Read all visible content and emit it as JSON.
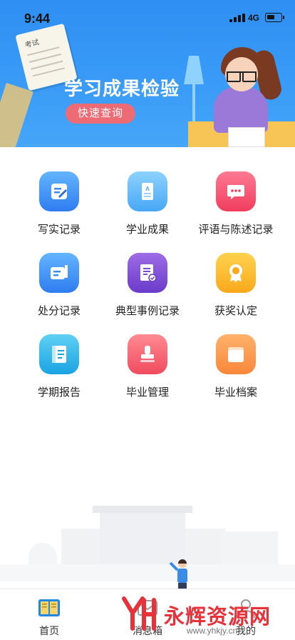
{
  "status_bar": {
    "time": "9:44",
    "network": "4G"
  },
  "banner": {
    "title": "学习成果检验",
    "button_label": "快速查询",
    "paper_text": "考试"
  },
  "grid": {
    "items": [
      {
        "label": "写实记录",
        "icon": "edit-note-icon",
        "color": "#3b8cf4"
      },
      {
        "label": "学业成果",
        "icon": "document-a-icon",
        "color": "#4aa8f6"
      },
      {
        "label": "评语与陈述记录",
        "icon": "chat-bubble-icon",
        "color": "#f24662"
      },
      {
        "label": "处分记录",
        "icon": "card-pen-icon",
        "color": "#3b8cf4"
      },
      {
        "label": "典型事例记录",
        "icon": "checklist-icon",
        "color": "#7b4bd3"
      },
      {
        "label": "获奖认定",
        "icon": "award-medal-icon",
        "color": "#fab327"
      },
      {
        "label": "学期报告",
        "icon": "report-book-icon",
        "color": "#2bb5ea"
      },
      {
        "label": "毕业管理",
        "icon": "stamp-icon",
        "color": "#f25468"
      },
      {
        "label": "毕业档案",
        "icon": "folder-archive-icon",
        "color": "#f99645"
      }
    ]
  },
  "tabbar": {
    "tabs": [
      {
        "label": "首页",
        "icon": "book-home-icon",
        "active": true
      },
      {
        "label": "消息箱",
        "icon": "message-box-icon",
        "active": false
      },
      {
        "label": "我的",
        "icon": "person-icon",
        "active": false
      }
    ]
  },
  "watermark": {
    "text": "永辉资源网",
    "url": "www.yhkjy.cn"
  }
}
